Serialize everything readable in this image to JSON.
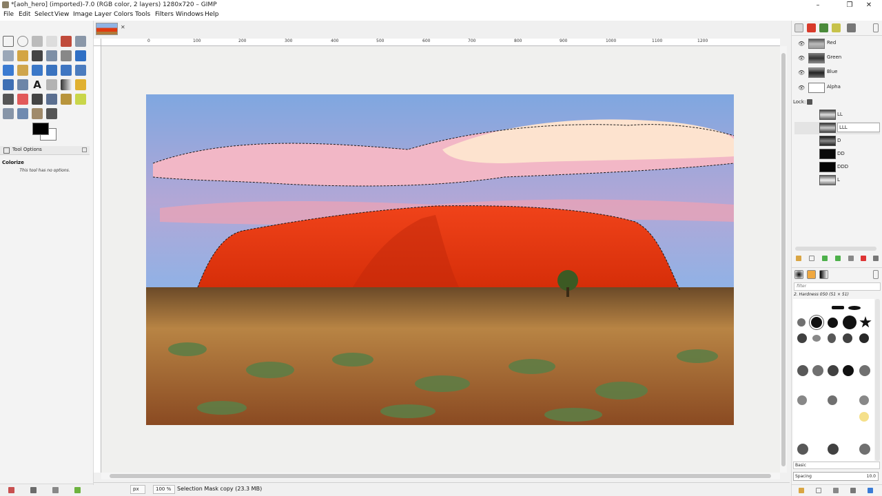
{
  "window": {
    "title": "*[aoh_hero] (imported)-7.0 (RGB color, 2 layers) 1280x720 – GIMP",
    "minimize": "–",
    "maximize": "❐",
    "close": "✕"
  },
  "menu": [
    "File",
    "Edit",
    "Select",
    "View",
    "Image",
    "Layer",
    "Colors",
    "Tools",
    "Filters",
    "Windows",
    "Help"
  ],
  "tool_options": {
    "tab_label": "Tool Options",
    "tool_name": "Colorize",
    "message": "This tool has no options."
  },
  "image_tab": {
    "close": "✕"
  },
  "ruler": {
    "top_labels": [
      "0",
      "100",
      "200",
      "300",
      "400",
      "500",
      "600",
      "700",
      "800",
      "900",
      "1000",
      "1100",
      "1200"
    ]
  },
  "statusbar": {
    "unit": "px",
    "zoom": "100 %",
    "message": "Selection Mask copy (23.3 MB)"
  },
  "channels": [
    {
      "name": "Red",
      "visible_icon": "eye-icon"
    },
    {
      "name": "Green",
      "visible_icon": "eye-icon"
    },
    {
      "name": "Blue",
      "visible_icon": "eye-icon"
    },
    {
      "name": "Alpha",
      "visible_icon": "eye-icon"
    }
  ],
  "lock_label": "Lock:",
  "layers": [
    {
      "name": "LL"
    },
    {
      "name": "LLL",
      "editing": true
    },
    {
      "name": "D"
    },
    {
      "name": "DD"
    },
    {
      "name": "DDD"
    },
    {
      "name": "L"
    }
  ],
  "brushes": {
    "filter_placeholder": "filter",
    "selected": "2. Hardness 050 (51 × 51)",
    "set": "Basic",
    "spacing_label": "Spacing",
    "spacing_value": "10.0"
  },
  "colors": {
    "foreground": "#000000",
    "background": "#ffffff",
    "sky": "#8fb2e6",
    "rock": "#e5360c",
    "grass": "#a8763a"
  }
}
